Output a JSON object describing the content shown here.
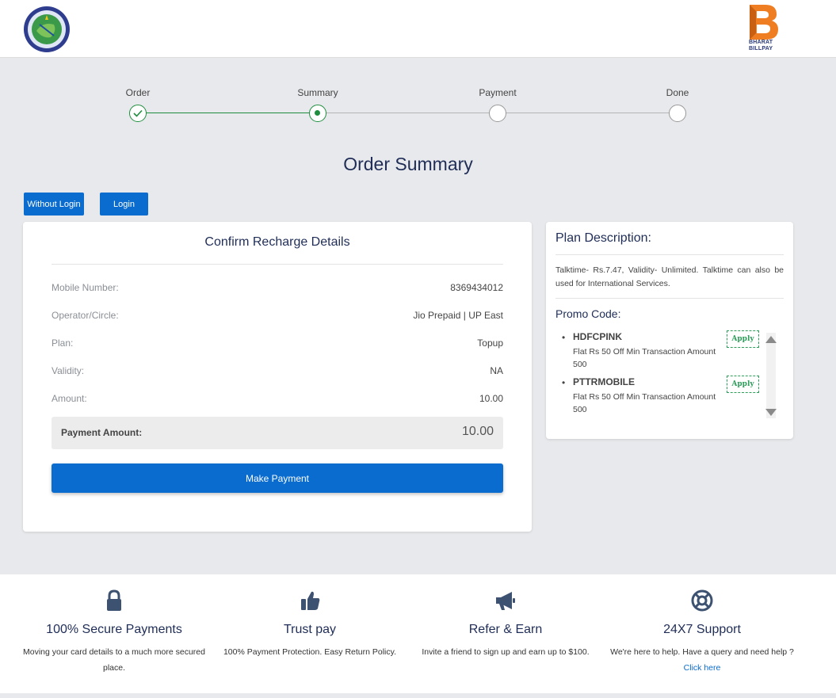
{
  "header": {
    "emblem_name": "state-emblem-logo",
    "bbps_logo_line1": "BHARAT",
    "bbps_logo_line2": "BILLPAY",
    "bbps_color": "#ef7d22"
  },
  "stepper": {
    "steps": [
      {
        "label": "Order",
        "state": "done"
      },
      {
        "label": "Summary",
        "state": "active"
      },
      {
        "label": "Payment",
        "state": "pending"
      },
      {
        "label": "Done",
        "state": "pending"
      }
    ],
    "done_color": "#1e8e3e"
  },
  "page_title": "Order Summary",
  "auth": {
    "without_login_label": "Without Login",
    "login_label": "Login"
  },
  "recharge": {
    "card_title": "Confirm Recharge Details",
    "rows": [
      {
        "label": "Mobile Number:",
        "value": "8369434012"
      },
      {
        "label": "Operator/Circle:",
        "value": "Jio Prepaid | UP East"
      },
      {
        "label": "Plan:",
        "value": "Topup"
      },
      {
        "label": "Validity:",
        "value": "NA"
      },
      {
        "label": "Amount:",
        "value": "10.00"
      }
    ],
    "payment_amount_label": "Payment Amount:",
    "payment_amount_value": "10.00",
    "make_payment_label": "Make Payment"
  },
  "plan": {
    "title": "Plan Description:",
    "description": "Talktime- Rs.7.47, Validity- Unlimited. Talktime can also be used for International Services.",
    "promo_title": "Promo Code:",
    "promos": [
      {
        "code": "HDFCPINK",
        "desc": "Flat Rs 50 Off Min Transaction Amount 500",
        "apply_label": "Apply"
      },
      {
        "code": "PTTRMOBILE",
        "desc": "Flat Rs 50 Off Min Transaction Amount 500",
        "apply_label": "Apply"
      }
    ]
  },
  "features": [
    {
      "icon": "lock-icon",
      "title": "100% Secure Payments",
      "desc": "Moving your card details to a much more secured place."
    },
    {
      "icon": "thumbs-up-icon",
      "title": "Trust pay",
      "desc": "100% Payment Protection. Easy Return Policy."
    },
    {
      "icon": "megaphone-icon",
      "title": "Refer & Earn",
      "desc": "Invite a friend to sign up and earn up to $100."
    },
    {
      "icon": "lifebuoy-icon",
      "title": "24X7 Support",
      "desc": "We're here to help. Have a query and need help ?",
      "link_label": "Click here"
    }
  ],
  "colors": {
    "primary": "#0a6ccf",
    "title": "#1f2d57",
    "icon": "#3d5170"
  }
}
